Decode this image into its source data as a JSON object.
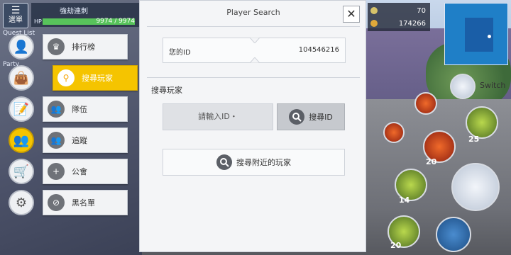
{
  "hud": {
    "menu_label": "選單",
    "player_name": "強劫連刺",
    "hp_label": "HP",
    "hp_value": "9974 / 9974",
    "hp_fraction": 1.0,
    "tag_1": "Quest List",
    "tag_2": "Party"
  },
  "left_menu": {
    "circles": [
      {
        "icon": "profile-icon"
      },
      {
        "icon": "bag-icon"
      },
      {
        "icon": "notes-icon"
      },
      {
        "icon": "friends-icon",
        "active": true
      },
      {
        "icon": "shop-cart-icon"
      },
      {
        "icon": "gear-icon"
      }
    ],
    "submenu": [
      {
        "label": "排行榜",
        "icon": "crown-icon"
      },
      {
        "label": "搜尋玩家",
        "icon": "search-player-icon",
        "active": true
      },
      {
        "label": "隊伍",
        "icon": "party-icon"
      },
      {
        "label": "追蹤",
        "icon": "follow-icon"
      },
      {
        "label": "公會",
        "icon": "guild-icon"
      },
      {
        "label": "黑名單",
        "icon": "block-icon"
      }
    ]
  },
  "dialog": {
    "title": "Player Search",
    "close_label": "✕",
    "my_id_label": "您的ID",
    "my_id_value": "104546216",
    "section_title": "搜尋玩家",
    "id_input_placeholder": "請輸入ID・",
    "search_id_label": "搜尋ID",
    "nearby_label": "搜尋附近的玩家"
  },
  "right_hud": {
    "stat_1": "70",
    "stat_2": "174266",
    "switch_label": "Switch",
    "skill_counts": [
      "25",
      "20",
      "14",
      "20"
    ]
  },
  "colors": {
    "accent_yellow": "#f5c400",
    "dialog_bg": "#f4f5f7",
    "hp_green": "#58c35b"
  }
}
